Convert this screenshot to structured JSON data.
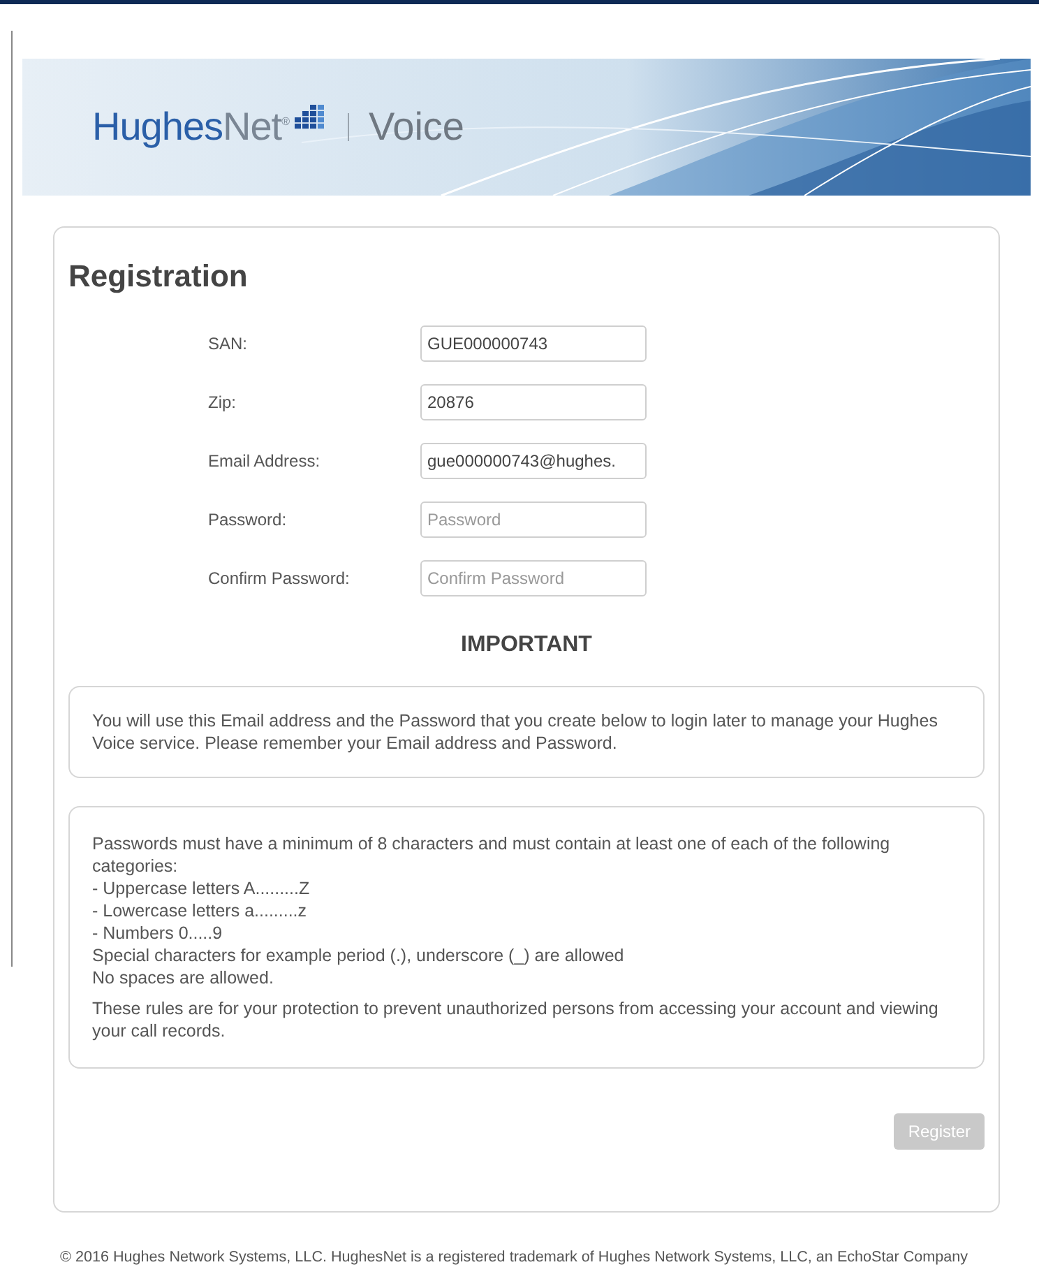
{
  "header": {
    "brand_parts": [
      "Hughes",
      "Net"
    ],
    "brand_mark": "®",
    "product": "Voice"
  },
  "form": {
    "title": "Registration",
    "fields": [
      {
        "label": "SAN:",
        "value": "GUE000000743"
      },
      {
        "label": "Zip:",
        "value": "20876"
      },
      {
        "label": "Email Address:",
        "value": "gue000000743@hughes."
      },
      {
        "label": "Password:",
        "placeholder": "Password"
      },
      {
        "label": "Confirm Password:",
        "placeholder": "Confirm Password"
      }
    ],
    "important_heading": "IMPORTANT",
    "notice": "You will use this Email address and the Password that you create below to login later to manage your Hughes Voice service. Please remember your Email address and Password.",
    "rules": {
      "intro": "Passwords must have a minimum of 8 characters and must contain at least one of each of the following categories:",
      "lines": [
        "- Uppercase letters A.........Z",
        "- Lowercase letters a.........z",
        "- Numbers 0.....9",
        "Special characters for example period (.), underscore (_) are allowed",
        "No spaces are allowed."
      ],
      "note": "These rules are for your protection to prevent unauthorized persons from accessing your account and viewing your call records."
    },
    "submit": {
      "label": "Register",
      "disabled": true
    }
  },
  "footer": "© 2016 Hughes Network Systems, LLC. HughesNet is a registered trademark of Hughes Network Systems, LLC, an EchoStar Company"
}
